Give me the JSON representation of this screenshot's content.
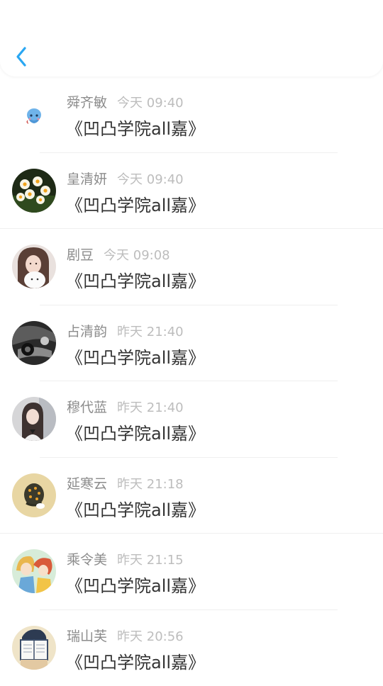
{
  "header": {
    "back_icon": "chevron-left-icon",
    "accent_color": "#2aa7f2"
  },
  "items": [
    {
      "name": "舜齐敏",
      "time": "今天 09:40",
      "message": "《凹凸学院all嘉》",
      "avatar": "blue-cartoon-avatar"
    },
    {
      "name": "皇清妍",
      "time": "今天 09:40",
      "message": "《凹凸学院all嘉》",
      "avatar": "daffodil-flowers-avatar"
    },
    {
      "name": "剧豆",
      "time": "今天 09:08",
      "message": "《凹凸学院all嘉》",
      "avatar": "girl-with-puppy-avatar"
    },
    {
      "name": "占清韵",
      "time": "昨天 21:40",
      "message": "《凹凸学院all嘉》",
      "avatar": "dark-car-avatar"
    },
    {
      "name": "穆代蓝",
      "time": "昨天 21:40",
      "message": "《凹凸学院all嘉》",
      "avatar": "girl-portrait-avatar"
    },
    {
      "name": "延寒云",
      "time": "昨天 21:18",
      "message": "《凹凸学院all嘉》",
      "avatar": "cartoon-egg-avatar"
    },
    {
      "name": "乘令美",
      "time": "昨天 21:15",
      "message": "《凹凸学院all嘉》",
      "avatar": "anime-characters-avatar"
    },
    {
      "name": "瑞山芙",
      "time": "昨天 20:56",
      "message": "《凹凸学院all嘉》",
      "avatar": "book-reading-avatar"
    }
  ]
}
